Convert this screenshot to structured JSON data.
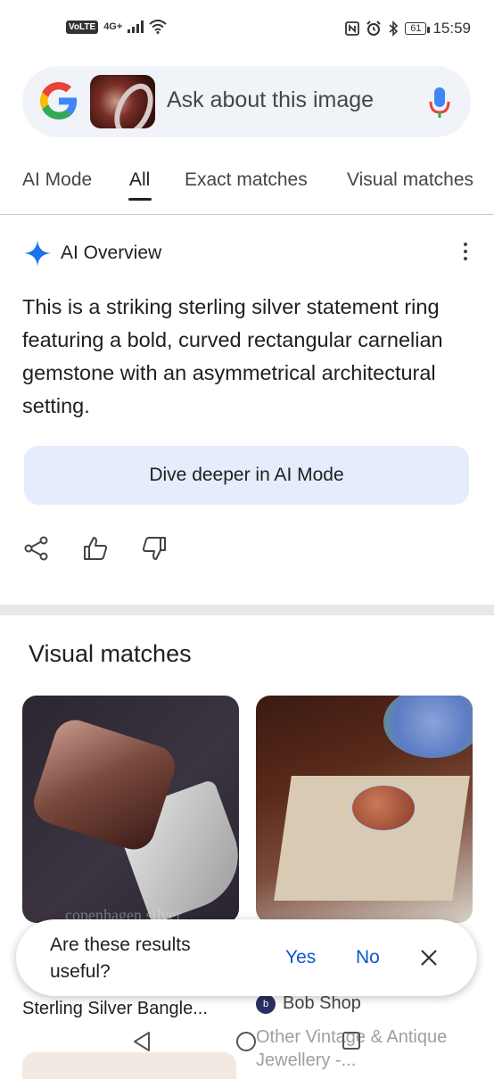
{
  "status_bar": {
    "volte": "VoLTE",
    "network": "4G+",
    "battery": "61",
    "time": "15:59",
    "icons": [
      "signal-icon",
      "wifi-icon",
      "nfc-icon",
      "alarm-icon",
      "bluetooth-icon",
      "battery-icon"
    ]
  },
  "search": {
    "placeholder": "Ask about this image",
    "icons": [
      "google-logo-icon",
      "image-thumbnail",
      "mic-icon"
    ]
  },
  "tabs": [
    {
      "label": "AI Mode"
    },
    {
      "label": "All",
      "active": true
    },
    {
      "label": "Exact matches"
    },
    {
      "label": "Visual matches"
    }
  ],
  "ai_overview": {
    "title": "AI Overview",
    "text": "This is a striking sterling silver statement ring featuring a bold, curved rectangular carnelian gemstone with an asymmetrical architectural setting.",
    "dive_button": "Dive deeper in AI Mode",
    "accent": "#1a73e8"
  },
  "visual_matches": {
    "title": "Visual matches",
    "cards": [
      {
        "watermark": "copenhagen silver",
        "caption": "Sterling Silver Bangle..."
      },
      {
        "source": "Bob Shop",
        "caption": "Other Vintage & Antique Jewellery -..."
      }
    ]
  },
  "feedback": {
    "question": "Are these results useful?",
    "yes": "Yes",
    "no": "No",
    "accent": "#0b57d0"
  }
}
